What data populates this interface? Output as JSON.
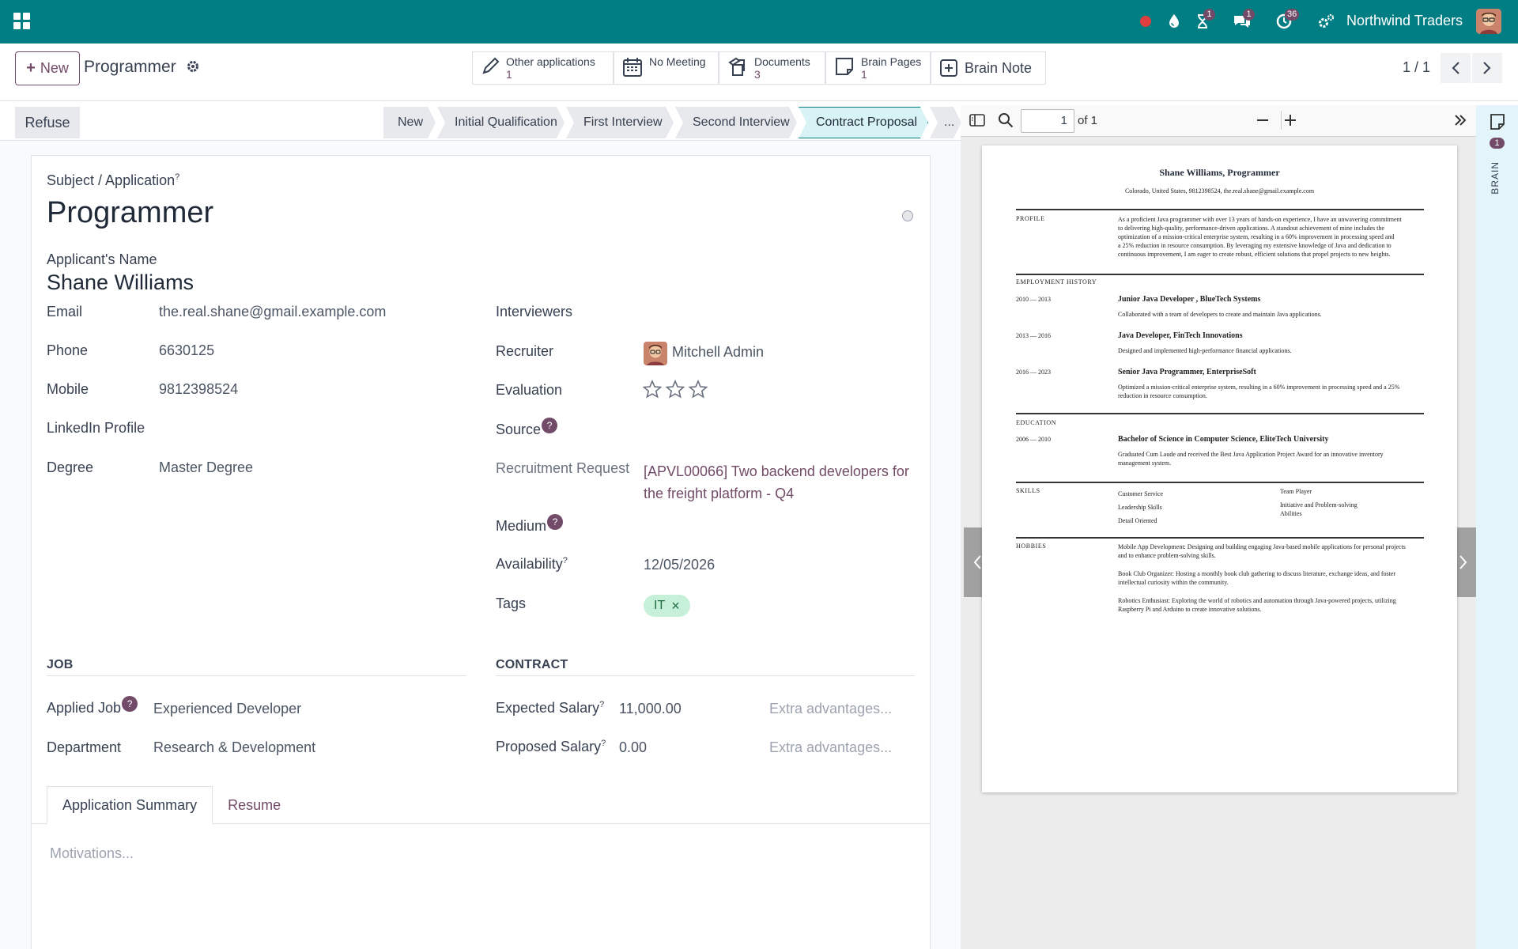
{
  "navbar": {
    "company": "Northwind Traders",
    "badges": {
      "activity": "1",
      "messages": "1",
      "clock": "36"
    },
    "icons": [
      "apps-grid-icon",
      "record-dot-icon",
      "drop-icon",
      "hourglass-icon",
      "chat-icon",
      "clock-icon",
      "settings-icon"
    ]
  },
  "control_panel": {
    "new_label": "New",
    "breadcrumb": "Programmer",
    "smart_buttons": [
      {
        "label": "Other applications",
        "count": "1",
        "icon": "pencil-icon"
      },
      {
        "label": "No Meeting",
        "count": "",
        "icon": "calendar-icon"
      },
      {
        "label": "Documents",
        "count": "3",
        "icon": "documents-icon"
      },
      {
        "label": "Brain Pages",
        "count": "1",
        "icon": "note-icon"
      },
      {
        "label": "Brain Note",
        "count": "",
        "icon": "plus-square-icon"
      }
    ],
    "pager": "1 / 1"
  },
  "statusbar": {
    "refuse_label": "Refuse",
    "stages": [
      "New",
      "Initial Qualification",
      "First Interview",
      "Second Interview",
      "Contract Proposal",
      "..."
    ],
    "active_stage": "Contract Proposal"
  },
  "form": {
    "subject_label": "Subject / Application",
    "subject_value": "Programmer",
    "applicant_label": "Applicant's Name",
    "applicant_value": "Shane Williams",
    "left_fields": [
      {
        "label": "Email",
        "value": "the.real.shane@gmail.example.com"
      },
      {
        "label": "Phone",
        "value": "6630125"
      },
      {
        "label": "Mobile",
        "value": "9812398524"
      },
      {
        "label": "LinkedIn Profile",
        "value": ""
      },
      {
        "label": "Degree",
        "value": "Master Degree"
      }
    ],
    "interviewers_label": "Interviewers",
    "recruiter_label": "Recruiter",
    "recruiter_value": "Mitchell Admin",
    "evaluation_label": "Evaluation",
    "evaluation_stars": 0,
    "source_label": "Source",
    "recruitment_request_label": "Recruitment Request",
    "recruitment_request_line1": "[APVL00066] Two backend developers for",
    "recruitment_request_line2": "the freight platform - Q4",
    "medium_label": "Medium",
    "availability_label": "Availability",
    "availability_value": "12/05/2026",
    "tags_label": "Tags",
    "tags": [
      "IT"
    ],
    "job_section": "JOB",
    "applied_job_label": "Applied Job",
    "applied_job_value": "Experienced Developer",
    "department_label": "Department",
    "department_value": "Research & Development",
    "contract_section": "CONTRACT",
    "expected_salary_label": "Expected Salary",
    "expected_salary_value": "11,000.00",
    "proposed_salary_label": "Proposed Salary",
    "proposed_salary_value": "0.00",
    "extra_placeholder": "Extra advantages...",
    "tabs": [
      "Application Summary",
      "Resume"
    ],
    "motivations_placeholder": "Motivations..."
  },
  "pdf_viewer": {
    "page_input": "1",
    "page_total": "of 1",
    "resume": {
      "name": "Shane Williams, Programmer",
      "contact": "Colorado, United States, 9812398524, the.real.shane@gmail.example.com",
      "profile_heading": "PROFILE",
      "profile_lines": [
        "As a proficient Java programmer with over 13 years of hands-on experience, I have an unwavering commitment",
        "to delivering high-quality, performance-driven applications. A standout achievement of mine includes the",
        "optimization of a mission-critical enterprise system, resulting in a 60% improvement in processing speed and",
        "a 25% reduction in resource consumption. By leveraging my extensive knowledge of Java and dedication to",
        "continuous improvement, I am eager to create robust, efficient solutions that propel projects to new heights."
      ],
      "employment_heading": "EMPLOYMENT HISTORY",
      "jobs": [
        {
          "years": "2010 — 2013",
          "title": "Junior Java Developer , BlueTech Systems",
          "desc": [
            "Collaborated with a team of developers to create and maintain Java applications."
          ]
        },
        {
          "years": "2013 — 2016",
          "title": "Java Developer, FinTech Innovations",
          "desc": [
            "Designed and implemented high-performance financial applications."
          ]
        },
        {
          "years": "2016 — 2023",
          "title": "Senior Java Programmer, EnterpriseSoft",
          "desc": [
            "Optimized a mission-critical enterprise system, resulting in a 60% improvement in processing speed and a 25%",
            "reduction in resource consumption."
          ]
        }
      ],
      "education_heading": "EDUCATION",
      "edu_years": "2006 — 2010",
      "edu_title": "Bachelor of Science in Computer Science, EliteTech University",
      "edu_desc": [
        "Graduated Cum Laude and received the Best Java Application Project Award for an innovative inventory",
        "management system."
      ],
      "skills_heading": "SKILLS",
      "skills_left": [
        "Customer Service",
        "Leadership Skills",
        "Detail Oriented"
      ],
      "skills_right": [
        "Team Player",
        "Initiative and Problem-solving",
        "Abilities"
      ],
      "hobbies_heading": "HOBBIES",
      "hobbies": [
        [
          "Mobile App Development: Designing and building engaging Java-based mobile applications for personal projects",
          "and to enhance problem-solving skills."
        ],
        [
          "Book Club Organizer: Hosting a monthly book club gathering to discuss literature, exchange ideas, and foster",
          "intellectual curiosity within the community."
        ],
        [
          "Robotics Enthusiast: Exploring the world of robotics and automation through Java-powered projects, utilizing",
          "Raspberry Pi and Arduino to create innovative solutions."
        ]
      ]
    }
  },
  "brain_bar": {
    "label": "BRAIN",
    "count": "1"
  },
  "colors": {
    "navbar": "#017e84",
    "primary": "#714b67",
    "active_stage": "#d8f3f5",
    "tag": "#c7f0d9"
  }
}
